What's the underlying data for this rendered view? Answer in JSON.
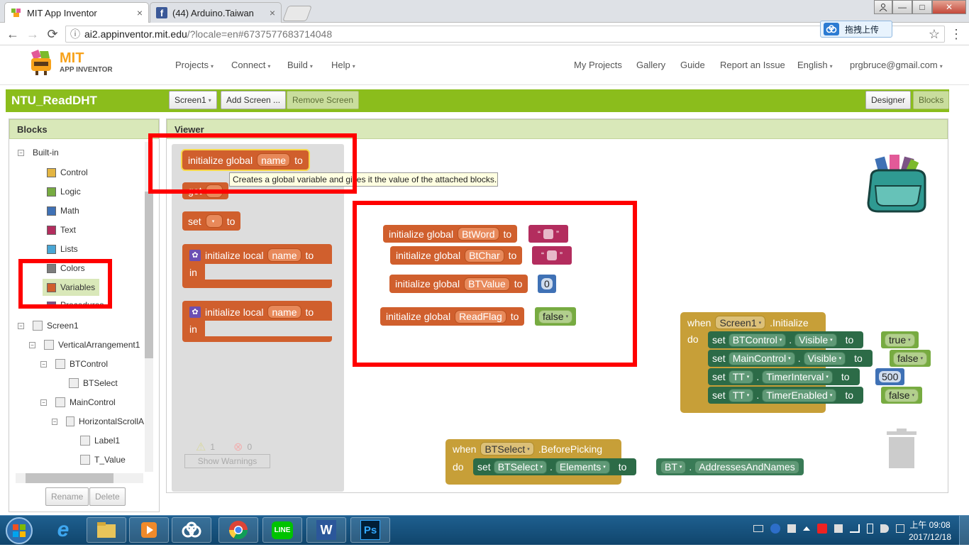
{
  "browser": {
    "tabs": [
      {
        "title": "MIT App Inventor",
        "close": "×"
      },
      {
        "title": "(44) Arduino.Taiwan",
        "close": "×"
      }
    ],
    "fb_icon": "f",
    "url_host": "ai2.appinventor.mit.edu",
    "url_path": "/?locale=en#6737577683714048",
    "upload_label": "拖拽上传",
    "upload_icon": "cloud-icon",
    "star": "☆",
    "more": "⋮",
    "back": "←",
    "forward": "→",
    "reload": "⟳",
    "info": "ⓘ",
    "win_min": "—",
    "win_max": "□",
    "win_close": "✕"
  },
  "app": {
    "logo_mit": "MIT",
    "logo_sub": "APP INVENTOR",
    "menus": [
      "Projects",
      "Connect",
      "Build",
      "Help"
    ],
    "right_menus": [
      "My Projects",
      "Gallery",
      "Guide",
      "Report an Issue",
      "English",
      "prgbruce@gmail.com"
    ],
    "project_name": "NTU_ReadDHT",
    "screen_btn": "Screen1",
    "add_screen": "Add Screen ...",
    "remove_screen": "Remove Screen",
    "designer": "Designer",
    "blocks_btn": "Blocks",
    "caret": "▾"
  },
  "blocks_panel": {
    "header": "Blocks",
    "builtin": "Built-in",
    "items": [
      {
        "label": "Control",
        "color": "#e3b542"
      },
      {
        "label": "Logic",
        "color": "#77ab41"
      },
      {
        "label": "Math",
        "color": "#3f71b5"
      },
      {
        "label": "Text",
        "color": "#b32d5e"
      },
      {
        "label": "Lists",
        "color": "#49a6d4"
      },
      {
        "label": "Colors",
        "color": "#7d7d7d"
      },
      {
        "label": "Variables",
        "color": "#d05f2d"
      },
      {
        "label": "Procedures",
        "color": "#7c5385"
      }
    ],
    "tree": {
      "screen1": "Screen1",
      "va1": "VerticalArrangement1",
      "btcontrol": "BTControl",
      "btselect": "BTSelect",
      "maincontrol": "MainControl",
      "hscroll": "HorizontalScrollA",
      "label1": "Label1",
      "tvalue": "T_Value"
    },
    "rename": "Rename",
    "delete": "Delete",
    "minus": "−"
  },
  "viewer": {
    "header": "Viewer",
    "tooltip": "Creates a global variable and gives it the value of the attached blocks.",
    "drawer": {
      "init_global": "initialize global",
      "name": "name",
      "to": "to",
      "get": "get",
      "set": "set",
      "init_local": "initialize local",
      "in": "in",
      "warn_count": "1",
      "err_count": "0",
      "show_warnings": "Show Warnings",
      "warn_icon": "⚠",
      "err_icon": "⊗"
    },
    "globals": [
      {
        "prefix": "initialize global",
        "name": "BtWord",
        "to": "to",
        "kind": "text"
      },
      {
        "prefix": "initialize global",
        "name": "BtChar",
        "to": "to",
        "kind": "text"
      },
      {
        "prefix": "initialize global",
        "name": "BTValue",
        "to": "to",
        "kind": "number",
        "value": "0"
      },
      {
        "prefix": "initialize global",
        "name": "ReadFlag",
        "to": "to",
        "kind": "logic",
        "value": "false"
      }
    ],
    "quote_open": "“",
    "quote_close": "”",
    "screen_init": {
      "when": "when",
      "component": "Screen1",
      "event": ".Initialize",
      "do": "do",
      "rows": [
        {
          "set": "set",
          "comp": "BTControl",
          "prop": "Visible",
          "to": "to",
          "value": "true",
          "kind": "logic"
        },
        {
          "set": "set",
          "comp": "MainControl",
          "prop": "Visible",
          "to": "to",
          "value": "false",
          "kind": "logic"
        },
        {
          "set": "set",
          "comp": "TT",
          "prop": "TimerInterval",
          "to": "to",
          "value": "500",
          "kind": "number"
        },
        {
          "set": "set",
          "comp": "TT",
          "prop": "TimerEnabled",
          "to": "to",
          "value": "false",
          "kind": "logic"
        }
      ]
    },
    "picking": {
      "when": "when",
      "component": "BTSelect",
      "event": ".BeforePicking",
      "do": "do",
      "set": "set",
      "comp": "BTSelect",
      "prop": "Elements",
      "to": "to",
      "src": "BT",
      "src_prop": "AddressesAndNames"
    },
    "dot": "."
  },
  "taskbar": {
    "clock_time": "上午 09:08",
    "clock_date": "2017/12/18",
    "apps": [
      "ie-icon",
      "explorer-icon",
      "media-icon",
      "cloud-icon",
      "chrome-icon",
      "line-icon",
      "word-icon",
      "photoshop-icon"
    ],
    "line": "LINE",
    "word": "W",
    "ps": "Ps",
    "ie": "e"
  }
}
